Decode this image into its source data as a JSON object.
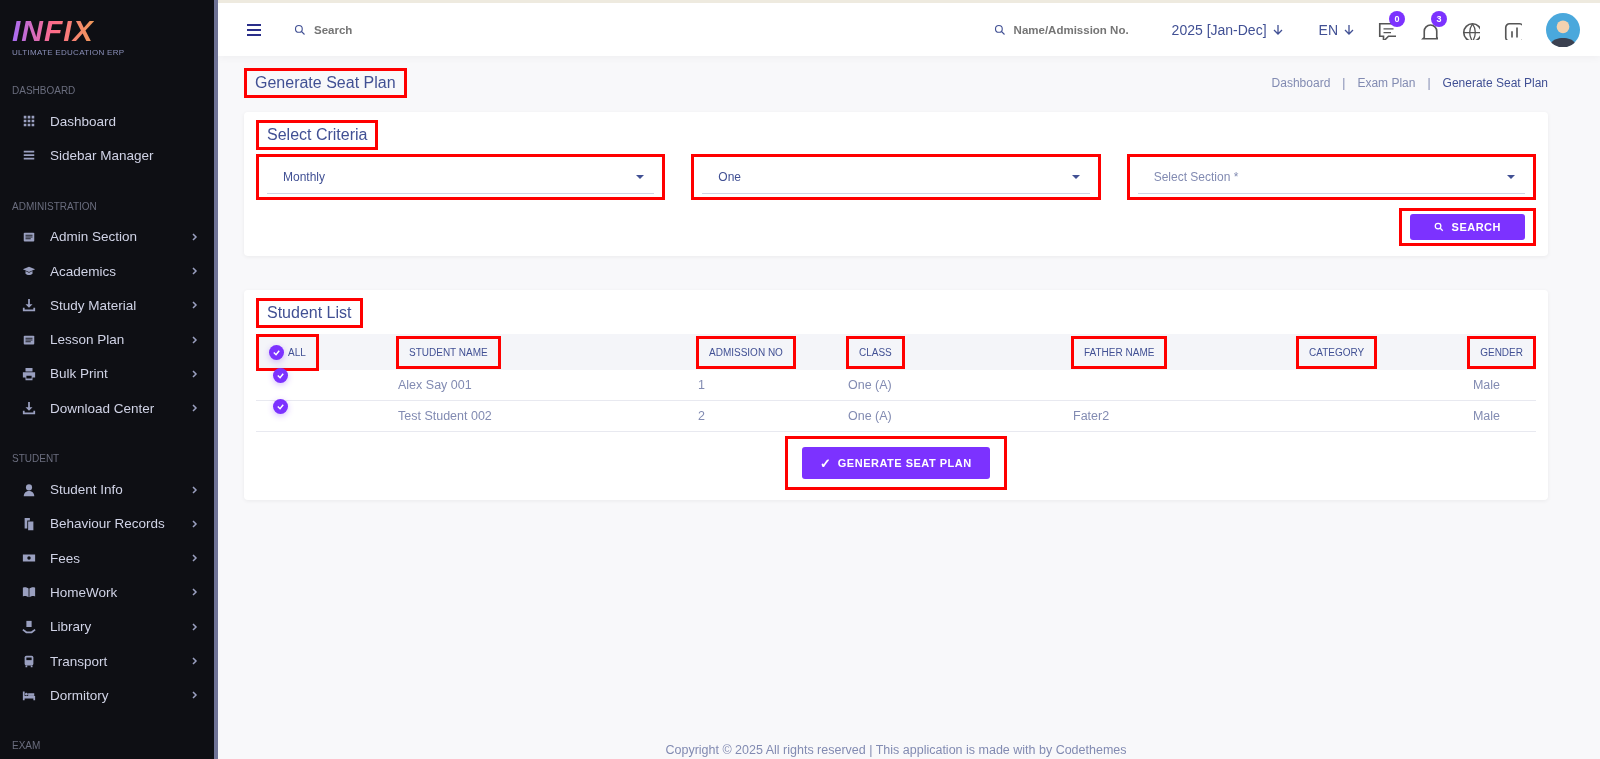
{
  "sidebar": {
    "logo": {
      "name": "INFIX",
      "tagline": "ULTIMATE EDUCATION ERP"
    },
    "sections": [
      {
        "heading": "DASHBOARD",
        "items": [
          {
            "label": "Dashboard",
            "expandable": false
          },
          {
            "label": "Sidebar Manager",
            "expandable": false
          }
        ]
      },
      {
        "heading": "ADMINISTRATION",
        "items": [
          {
            "label": "Admin Section",
            "expandable": true
          },
          {
            "label": "Academics",
            "expandable": true
          },
          {
            "label": "Study Material",
            "expandable": true
          },
          {
            "label": "Lesson Plan",
            "expandable": true
          },
          {
            "label": "Bulk Print",
            "expandable": true
          },
          {
            "label": "Download Center",
            "expandable": true
          }
        ]
      },
      {
        "heading": "STUDENT",
        "items": [
          {
            "label": "Student Info",
            "expandable": true
          },
          {
            "label": "Behaviour Records",
            "expandable": true
          },
          {
            "label": "Fees",
            "expandable": true
          },
          {
            "label": "HomeWork",
            "expandable": true
          },
          {
            "label": "Library",
            "expandable": true
          },
          {
            "label": "Transport",
            "expandable": true
          },
          {
            "label": "Dormitory",
            "expandable": true
          }
        ]
      },
      {
        "heading": "EXAM"
      }
    ]
  },
  "header": {
    "search_placeholder": "Search",
    "student_search_placeholder": "Name/Admission No.",
    "session": "2025 [Jan-Dec]",
    "language": "EN",
    "message_count": "0",
    "notification_count": "3"
  },
  "page": {
    "title": {
      "text": "Generate Seat Plan",
      "annotated": true
    },
    "breadcrumbs": [
      "Dashboard",
      "Exam Plan",
      "Generate Seat Plan"
    ],
    "breadcrumb_separator": "|"
  },
  "criteria": {
    "title": {
      "text": "Select Criteria",
      "annotated": true
    },
    "selects": [
      {
        "value": "Monthly",
        "annotated": true
      },
      {
        "value": "One",
        "annotated": true
      },
      {
        "placeholder": "Select Section *",
        "annotated": true
      }
    ],
    "search_button": {
      "label": "SEARCH",
      "annotated": true
    }
  },
  "student_list": {
    "title": {
      "text": "Student List",
      "annotated": true
    },
    "columns": [
      {
        "label": "ALL",
        "kind": "checkbox",
        "checked": true,
        "annotated": true
      },
      {
        "label": "STUDENT NAME",
        "kind": "text",
        "annotated": true
      },
      {
        "label": "ADMISSION NO",
        "kind": "text",
        "annotated": true
      },
      {
        "label": "CLASS",
        "kind": "text",
        "annotated": true
      },
      {
        "label": "FATHER NAME",
        "kind": "text",
        "annotated": true
      },
      {
        "label": "CATEGORY",
        "kind": "text",
        "annotated": true
      },
      {
        "label": "GENDER",
        "kind": "text",
        "annotated": true
      }
    ],
    "rows": [
      {
        "checked": true,
        "student_name": "Alex Say 001",
        "admission_no": "1",
        "class": "One (A)",
        "gender": "Male"
      },
      {
        "checked": true,
        "student_name": "Test Student 002",
        "admission_no": "2",
        "class": "One (A)",
        "father_name": "Fater2",
        "gender": "Male"
      }
    ],
    "generate_button": {
      "label": "GENERATE SEAT PLAN",
      "icon": "✓",
      "annotated": true
    }
  },
  "footer": {
    "text": "Copyright © 2025 All rights reserved | This application is made with by Codethemes"
  }
}
